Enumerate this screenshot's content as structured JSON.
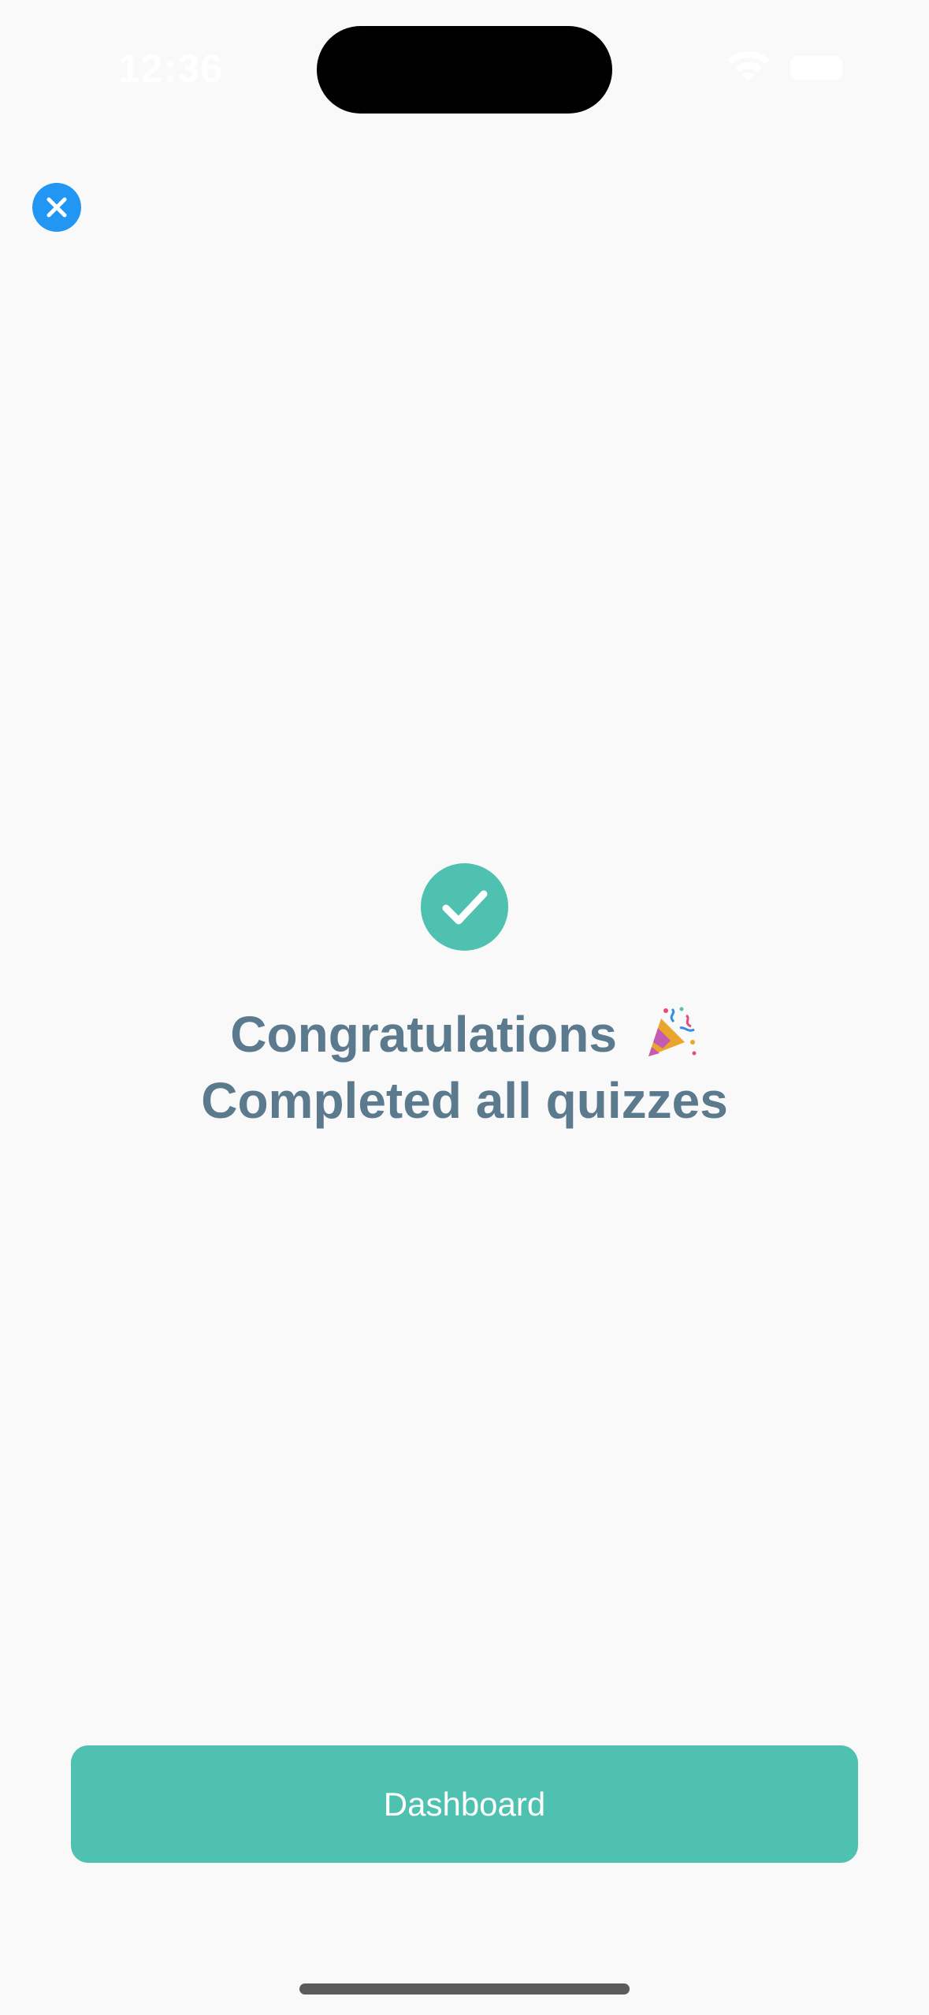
{
  "status_bar": {
    "time": "12:36",
    "wifi_icon": "wifi-icon",
    "battery_icon": "battery-icon"
  },
  "header": {
    "close_icon": "close-icon",
    "close_color": "#2196f3"
  },
  "main": {
    "success_icon": "checkmark-circle-icon",
    "accent_color": "#4fc1b0",
    "title": "Congratulations",
    "title_emoji_icon": "party-popper-icon",
    "subtitle": "Completed all quizzes"
  },
  "footer": {
    "dashboard_label": "Dashboard"
  }
}
